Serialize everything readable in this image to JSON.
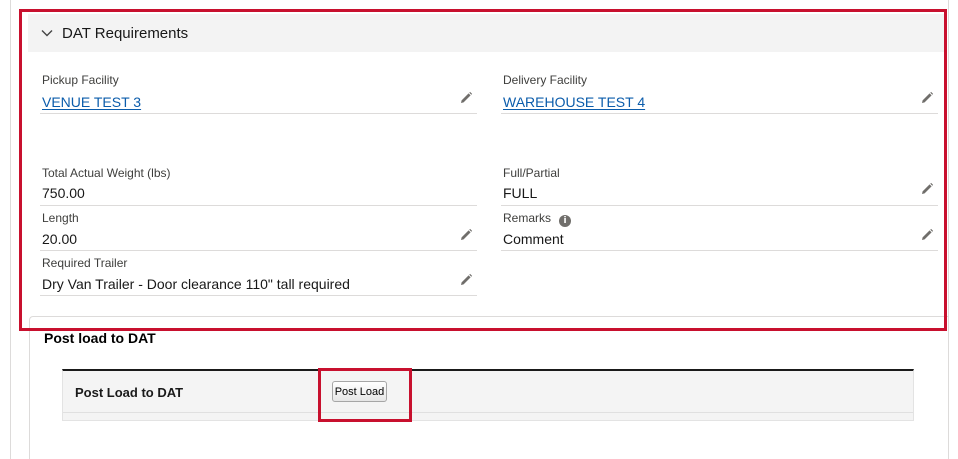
{
  "section": {
    "title": "DAT Requirements",
    "icon": "chevron-down-icon"
  },
  "fields": {
    "pickup_facility": {
      "label": "Pickup Facility",
      "value": "VENUE TEST 3"
    },
    "delivery_facility": {
      "label": "Delivery Facility",
      "value": "WAREHOUSE TEST 4"
    },
    "total_actual_weight": {
      "label": "Total Actual Weight (lbs)",
      "value": "750.00"
    },
    "full_partial": {
      "label": "Full/Partial",
      "value": "FULL"
    },
    "length": {
      "label": "Length",
      "value": "20.00"
    },
    "remarks": {
      "label": "Remarks",
      "value": "Comment",
      "info_icon": "i"
    },
    "required_trailer": {
      "label": "Required Trailer",
      "value": "Dry Van Trailer - Door clearance 110\" tall required"
    }
  },
  "post": {
    "heading": "Post load to DAT",
    "panel_title": "Post Load to DAT",
    "button_label": "Post Load"
  },
  "colors": {
    "link": "#0b5cab",
    "highlight": "#c8102e",
    "header_bg": "#f3f3f3"
  }
}
